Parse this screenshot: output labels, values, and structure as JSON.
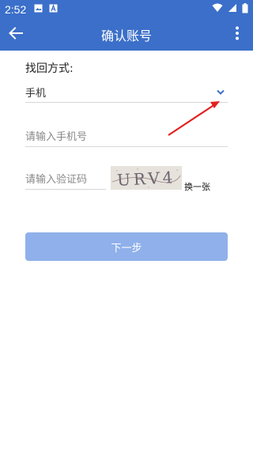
{
  "status_bar": {
    "time": "2:52",
    "icons": [
      "image-icon",
      "a-icon",
      "wifi-icon",
      "signal-icon",
      "battery-icon"
    ]
  },
  "app_bar": {
    "title": "确认账号",
    "back_icon": "arrow-left-icon",
    "menu_icon": "more-vert-icon"
  },
  "form": {
    "method_label": "找回方式:",
    "method_value": "手机",
    "phone_placeholder": "请输入手机号",
    "captcha_placeholder": "请输入验证码",
    "captcha_text": "URV4",
    "refresh_label": "换一张",
    "next_label": "下一步"
  },
  "colors": {
    "primary": "#3b6fc9",
    "button_disabled": "#8fb0ea",
    "annotation": "#e32020"
  }
}
